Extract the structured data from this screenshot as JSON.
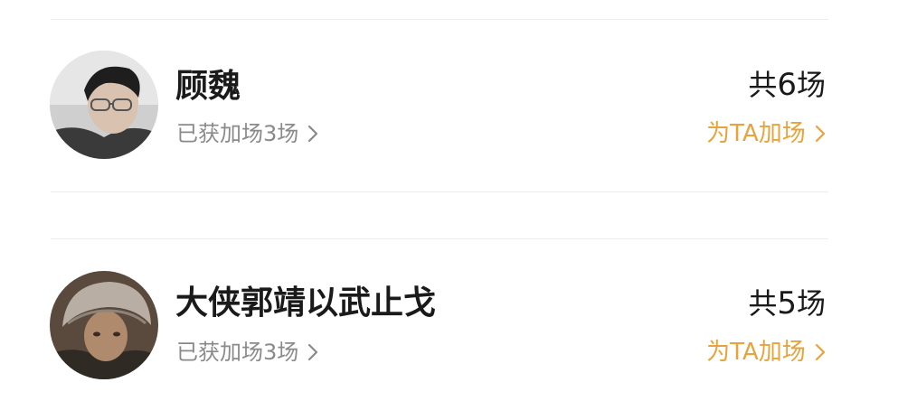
{
  "list": [
    {
      "name": "顾魏",
      "obtained_label": "已获加场3场",
      "total_prefix": "共",
      "total_count": "6",
      "total_suffix": "场",
      "boost_label": "为TA加场",
      "avatar_icon": "person-portrait-icon"
    },
    {
      "name": "大侠郭靖以武止戈",
      "obtained_label": "已获加场3场",
      "total_prefix": "共",
      "total_count": "5",
      "total_suffix": "场",
      "boost_label": "为TA加场",
      "avatar_icon": "person-fur-hat-portrait-icon"
    }
  ],
  "colors": {
    "accent": "#e8a33a",
    "text_primary": "#1a1a1a",
    "text_secondary": "#8a8a8a",
    "divider": "#ececec"
  }
}
